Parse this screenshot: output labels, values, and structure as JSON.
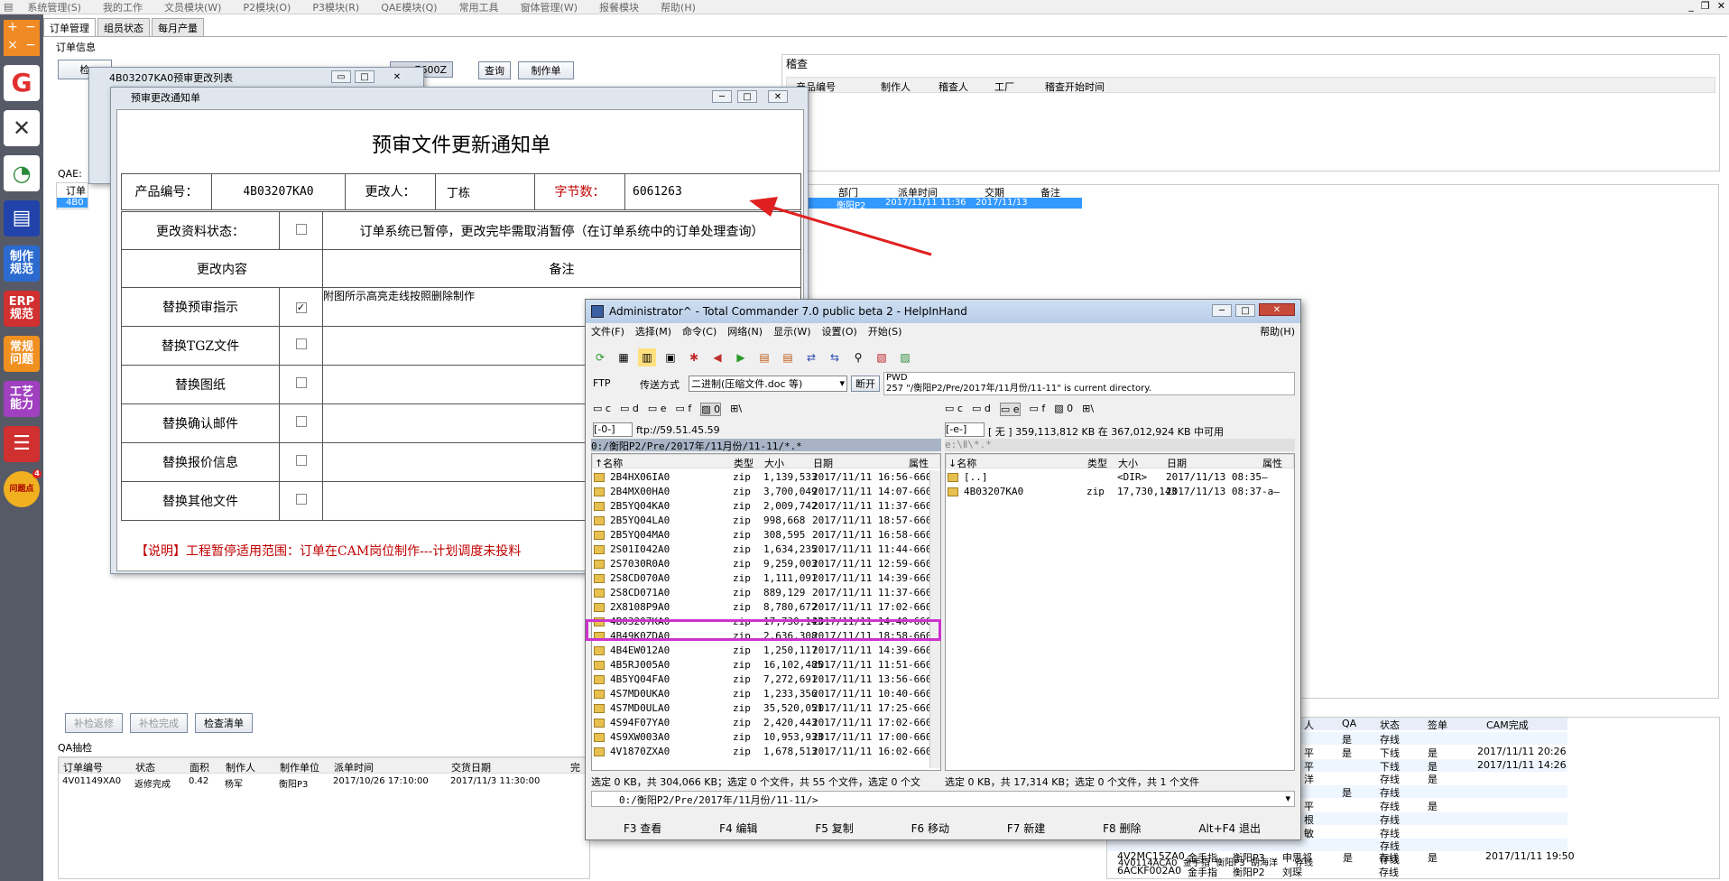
{
  "app": {
    "menu": [
      "系统管理(S)",
      "我的工作",
      "文员模块(W)",
      "P2模块(O)",
      "P3模块(R)",
      "QAE模块(Q)",
      "常用工具",
      "窗体管理(W)",
      "报餐模块",
      "帮助(H)"
    ],
    "win_controls": [
      "_",
      "❐",
      "✕"
    ]
  },
  "sidebar": {
    "items": [
      {
        "label": "",
        "icon": "logo-icon",
        "color": "#e03030"
      },
      {
        "label": "",
        "icon": "tools-icon",
        "color": "#333"
      },
      {
        "label": "",
        "icon": "chart-icon",
        "color": "#2a8a3a"
      },
      {
        "label": "",
        "icon": "save-icon",
        "color": "#2244aa"
      },
      {
        "label": "制作\n规范",
        "color": "#2b6bd0"
      },
      {
        "label": "ERP\n规范",
        "color": "#d03030"
      },
      {
        "label": "常规\n问题",
        "color": "#f09020"
      },
      {
        "label": "工艺\n能力",
        "color": "#a040c0"
      },
      {
        "label": "",
        "icon": "database-icon",
        "color": "#d03030"
      },
      {
        "label": "问题点",
        "badge": "4",
        "color": "#f0b020"
      }
    ]
  },
  "tabs": [
    "订单管理",
    "组员状态",
    "每月产量"
  ],
  "order_panel": {
    "group_label": "订单信息",
    "search_value": "7600Z",
    "query_btn": "查询",
    "make_btn": "制作单",
    "qae_label": "QAE:",
    "review_label": "稽查",
    "review_cols": [
      "产品编号",
      "制作人",
      "稽查人",
      "工厂",
      "稽查开始时间"
    ],
    "mid_cols": [
      "部门",
      "派单时间",
      "交期",
      "备注"
    ],
    "mid_row": [
      "衡阳P2",
      "2017/11/11 11:36",
      "2017/11/13",
      ""
    ],
    "left_partial": [
      "订单",
      "4B0"
    ]
  },
  "qa_panel": {
    "buttons": [
      "补检返修",
      "补检完成",
      "检查清单"
    ],
    "label": "QA抽检",
    "cols": [
      "订单编号",
      "状态",
      "面积",
      "制作人",
      "制作单位",
      "派单时间",
      "交货日期",
      "完"
    ],
    "row": [
      "4V01149XA0",
      "返修完成",
      "0.42",
      "杨军",
      "衡阳P3",
      "2017/10/26 17:10:00",
      "2017/11/3 11:30:00"
    ]
  },
  "right_panel": {
    "cols": [
      "人",
      "QA",
      "状态",
      "签单",
      "CAM完成"
    ],
    "rows": [
      [
        "",
        "是",
        "存线",
        "",
        ""
      ],
      [
        "平",
        "是",
        "下线",
        "是",
        "2017/11/11 20:26"
      ],
      [
        "平",
        "",
        "下线",
        "是",
        "2017/11/11 14:26"
      ],
      [
        "洋",
        "",
        "存线",
        "是",
        ""
      ],
      [
        "",
        "是",
        "存线",
        "",
        ""
      ],
      [
        "平",
        "",
        "存线",
        "是",
        ""
      ],
      [
        "根",
        "",
        "存线",
        "",
        ""
      ],
      [
        "敏",
        "",
        "存线",
        "",
        ""
      ],
      [
        "",
        "",
        "存线",
        "",
        ""
      ],
      [
        "",
        "",
        "存线",
        "",
        ""
      ]
    ],
    "bottom_rows": [
      [
        "4V0114ACA0",
        "金手指",
        "衡阳P3",
        "胡海洋",
        "",
        "存线"
      ],
      [
        "4V2MC15ZA0",
        "金手指",
        "衡阳P3",
        "申思祁",
        "是",
        "存线",
        "是",
        "2017/11/11 19:50"
      ],
      [
        "6ACKF002A0",
        "金手指",
        "衡阳P2",
        "刘琛",
        "",
        "存线"
      ]
    ]
  },
  "list_window": {
    "title": "4B03207KA0预审更改列表"
  },
  "notice": {
    "title": "预审更改通知单",
    "heading": "预审文件更新通知单",
    "product_label": "产品编号：",
    "product_value": "4B03207KA0",
    "changer_label": "更改人：",
    "changer_value": "丁栋",
    "bytes_label": "字节数：",
    "bytes_value": "6061263",
    "status_label": "更改资料状态：",
    "status_text": "订单系统已暂停，更改完毕需取消暂停（在订单系统中的订单处理查询）",
    "content_label": "更改内容",
    "remark_label": "备注",
    "items": [
      {
        "label": "替换预审指示",
        "checked": true,
        "remark": "附图所示高亮走线按照删除制作"
      },
      {
        "label": "替换TGZ文件",
        "checked": false,
        "remark": ""
      },
      {
        "label": "替换图纸",
        "checked": false,
        "remark": ""
      },
      {
        "label": "替换确认邮件",
        "checked": false,
        "remark": ""
      },
      {
        "label": "替换报价信息",
        "checked": false,
        "remark": ""
      },
      {
        "label": "替换其他文件",
        "checked": false,
        "remark": ""
      }
    ],
    "note": "【说明】工程暂停适用范围：订单在CAM岗位制作---计划调度未投料"
  },
  "tc": {
    "title": "Administrator^ - Total Commander 7.0 public beta 2 - HelpInHand",
    "menu": [
      "文件(F)",
      "选择(M)",
      "命令(C)",
      "网络(N)",
      "显示(W)",
      "设置(O)",
      "开始(S)"
    ],
    "help": "帮助(H)",
    "ftp_label": "FTP",
    "transfer_label": "传送方式",
    "transfer_value": "二进制(压缩文件.doc 等)",
    "disconnect": "断开",
    "log1": "PWD",
    "log2": "257 \"/衡阳P2/Pre/2017年/11月份/11-11\" is current directory.",
    "drives_left": [
      "c",
      "d",
      "e",
      "f",
      "0",
      "\\"
    ],
    "drives_right": [
      "c",
      "d",
      "e",
      "f",
      "0",
      "\\"
    ],
    "left_drive": "[-0-]",
    "left_host": "ftp://59.51.45.59",
    "right_drive": "[-e-]",
    "right_info": "[ 无 ]  359,113,812 KB 在 367,012,924 KB 中可用",
    "left_path": "0:/衡阳P2/Pre/2017年/11月份/11-11/*.*",
    "right_path": "e:\\Ⅱ\\*.*",
    "cols": [
      "↑名称",
      "类型",
      "大小",
      "日期",
      "属性"
    ],
    "rcols": [
      "↓名称",
      "类型",
      "大小",
      "日期",
      "属性"
    ],
    "left_files": [
      [
        "2B4HX06IA0",
        "zip",
        "1,139,533",
        "2017/11/11 16:56-660"
      ],
      [
        "2B4MX00HA0",
        "zip",
        "3,700,049",
        "2017/11/11 14:07-660"
      ],
      [
        "2B5YQ04KA0",
        "zip",
        "2,009,742",
        "2017/11/11 11:37-660"
      ],
      [
        "2B5YQ04LA0",
        "zip",
        "998,668",
        "2017/11/11 18:57-660"
      ],
      [
        "2B5YQ04MA0",
        "zip",
        "308,595",
        "2017/11/11 16:58-660"
      ],
      [
        "2S01I042A0",
        "zip",
        "1,634,235",
        "2017/11/11 11:44-660"
      ],
      [
        "2S7030R0A0",
        "zip",
        "9,259,003",
        "2017/11/11 12:59-660"
      ],
      [
        "2S8CD070A0",
        "zip",
        "1,111,091",
        "2017/11/11 14:39-660"
      ],
      [
        "2S8CD071A0",
        "zip",
        "889,129",
        "2017/11/11 11:37-660"
      ],
      [
        "2X8108P9A0",
        "zip",
        "8,780,672",
        "2017/11/11 17:02-660"
      ],
      [
        "4B03207KA0",
        "zip",
        "17,730,143",
        "2017/11/11 14:40-660"
      ],
      [
        "4B49K0ZDA0",
        "zip",
        "2,636,308",
        "2017/11/11 18:58-660"
      ],
      [
        "4B4EW012A0",
        "zip",
        "1,250,117",
        "2017/11/11 14:39-660"
      ],
      [
        "4B5RJ005A0",
        "zip",
        "16,102,485",
        "2017/11/11 11:51-660"
      ],
      [
        "4B5YQ04FA0",
        "zip",
        "7,272,691",
        "2017/11/11 13:56-660"
      ],
      [
        "4S7MD0UKA0",
        "zip",
        "1,233,356",
        "2017/11/11 10:40-660"
      ],
      [
        "4S7MD0ULA0",
        "zip",
        "35,520,051",
        "2017/11/11 17:25-660"
      ],
      [
        "4S94F07YA0",
        "zip",
        "2,420,443",
        "2017/11/11 17:02-660"
      ],
      [
        "4S9XW003A0",
        "zip",
        "10,953,933",
        "2017/11/11 17:00-660"
      ],
      [
        "4V1870ZXA0",
        "zip",
        "1,678,513",
        "2017/11/11 16:02-660"
      ]
    ],
    "right_files": [
      [
        "[..]",
        "",
        "<DIR>",
        "2017/11/13 08:35—"
      ],
      [
        "4B03207KA0",
        "zip",
        "17,730,143",
        "2017/11/13 08:37-a—"
      ]
    ],
    "status_left": "选定 0 KB，共 304,066 KB；选定 0 个文件，共 55 个文件，选定 0 个文",
    "status_right": "选定 0 KB，共 17,314 KB；选定 0 个文件，共 1 个文件",
    "cmd_path": "0:/衡阳P2/Pre/2017年/11月份/11-11/>",
    "fkeys": [
      "F3 查看",
      "F4 编辑",
      "F5 复制",
      "F6 移动",
      "F7 新建",
      "F8 删除",
      "Alt+F4 退出"
    ]
  },
  "colors": {
    "highlight": "#cc33cc",
    "arrow": "#e02020",
    "selected_row": "#3399ff",
    "note_red": "#c00000"
  }
}
